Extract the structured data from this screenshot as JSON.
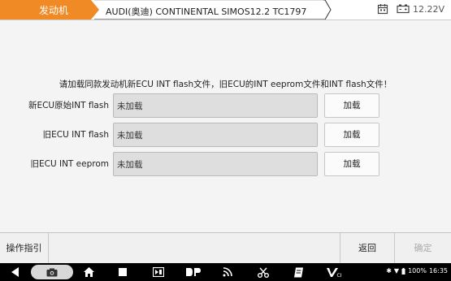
{
  "header": {
    "active_tab": "发动机",
    "breadcrumb": "AUDI(奥迪) CONTINENTAL SIMOS12.2 TC1797",
    "voltage": "12.22V"
  },
  "instruction": "请加载同款发动机新ECU INT flash文件，旧ECU的INT eeprom文件和INT flash文件！",
  "rows": [
    {
      "label": "新ECU原始INT flash",
      "value": "未加载",
      "button": "加载"
    },
    {
      "label": "旧ECU INT flash",
      "value": "未加载",
      "button": "加载"
    },
    {
      "label": "旧ECU INT eeprom",
      "value": "未加载",
      "button": "加载"
    }
  ],
  "actionbar": {
    "guide": "操作指引",
    "back": "返回",
    "confirm": "确定"
  },
  "statusbar": {
    "battery": "100%",
    "time": "16:35"
  }
}
